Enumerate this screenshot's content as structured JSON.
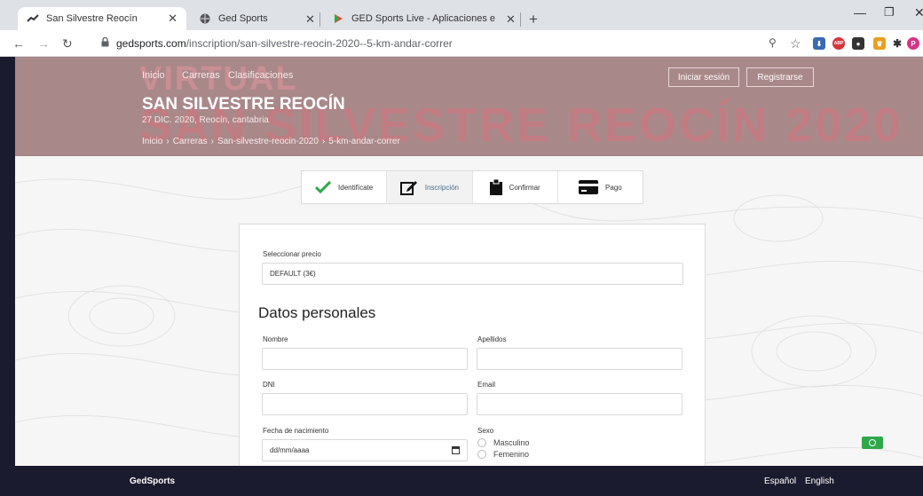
{
  "browser": {
    "tabs": [
      {
        "title": "San Silvestre Reocín",
        "active": true
      },
      {
        "title": "Ged Sports",
        "active": false
      },
      {
        "title": "GED Sports Live - Aplicaciones e",
        "active": false
      }
    ],
    "url_domain": "gedsports.com",
    "url_path": "/inscription/san-silvestre-reocin-2020--5-km-andar-correr",
    "profile_initial": "P",
    "abp_label": "ABP"
  },
  "hero": {
    "bg_line1": "VIRTUAL",
    "bg_line2": "SAN SILVESTRE REOCÍN 2020",
    "nav": [
      "Inicio",
      "Carreras",
      "Clasificaciones"
    ],
    "title": "SAN SILVESTRE REOCÍN",
    "date": "27 DIC. 2020, Reocín, cantabria",
    "breadcrumb": [
      "Inicio",
      "Carreras",
      "San-silvestre-reocin-2020",
      "5-km-andar-correr"
    ],
    "breadcrumb_sep": "›",
    "login": "Iniciar sesión",
    "register": "Registrarse"
  },
  "steps": [
    {
      "label": "Identifícate",
      "icon": "check-icon",
      "active": false
    },
    {
      "label": "Inscripción",
      "icon": "edit-icon",
      "active": true
    },
    {
      "label": "Confirmar",
      "icon": "clipboard-icon",
      "active": false
    },
    {
      "label": "Pago",
      "icon": "credit-card-icon",
      "active": false
    }
  ],
  "form": {
    "price_label": "Seleccionar precio",
    "price_value": "DEFAULT (3€)",
    "section_title": "Datos personales",
    "fields": {
      "nombre": {
        "label": "Nombre",
        "value": ""
      },
      "apellidos": {
        "label": "Apellidos",
        "value": ""
      },
      "dni": {
        "label": "DNI",
        "value": ""
      },
      "email": {
        "label": "Email",
        "value": ""
      },
      "birth": {
        "label": "Fecha de nacimiento",
        "placeholder": "dd/mm/aaaa"
      }
    },
    "sexo": {
      "label": "Sexo",
      "options": [
        "Masculino",
        "Femenino"
      ]
    }
  },
  "footer": {
    "brand": "GedSports",
    "languages": [
      "Español",
      "English"
    ]
  },
  "colors": {
    "hero_bg": "#a9888a",
    "footer_bg": "#1b1b2f",
    "check_green": "#2ea84a",
    "active_step_text": "#4a6b8a"
  }
}
